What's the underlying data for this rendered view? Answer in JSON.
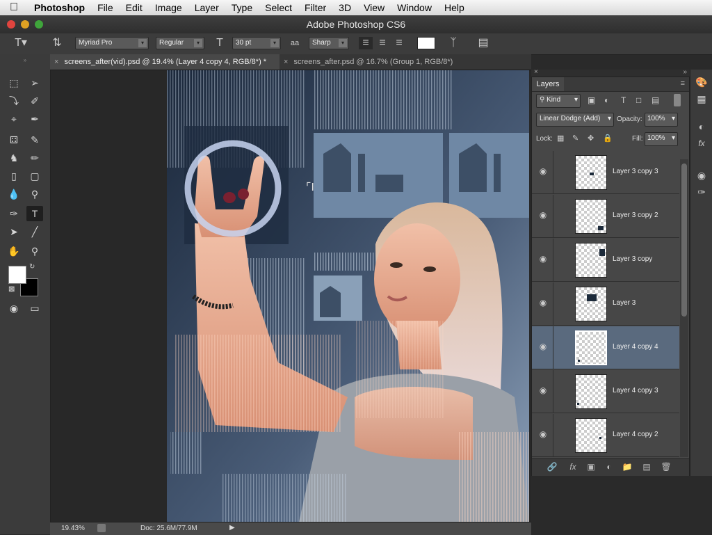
{
  "menubar": {
    "app_name": "Photoshop",
    "items": [
      "File",
      "Edit",
      "Image",
      "Layer",
      "Type",
      "Select",
      "Filter",
      "3D",
      "View",
      "Window",
      "Help"
    ]
  },
  "window": {
    "title": "Adobe Photoshop CS6"
  },
  "options_bar": {
    "font_family": "Myriad Pro",
    "font_style": "Regular",
    "font_size": "30 pt",
    "antialias": "Sharp",
    "text_color": "#ffffff"
  },
  "doc_tabs": [
    {
      "label": "screens_after(vid).psd @ 19.4% (Layer 4 copy 4, RGB/8*) *",
      "active": true
    },
    {
      "label": "screens_after.psd @ 16.7% (Group 1, RGB/8*)",
      "active": false
    }
  ],
  "status": {
    "zoom": "19.43%",
    "doc": "Doc: 25.6M/77.9M"
  },
  "layers_panel": {
    "tab": "Layers",
    "filter": "Kind",
    "blend_mode": "Linear Dodge (Add)",
    "opacity_label": "Opacity:",
    "opacity": "100%",
    "lock_label": "Lock:",
    "fill_label": "Fill:",
    "fill": "100%",
    "layers": [
      {
        "name": "Layer 3 copy 3",
        "selected": false
      },
      {
        "name": "Layer 3 copy 2",
        "selected": false
      },
      {
        "name": "Layer 3 copy",
        "selected": false
      },
      {
        "name": "Layer 3",
        "selected": false
      },
      {
        "name": "Layer 4 copy 4",
        "selected": true
      },
      {
        "name": "Layer 4 copy 3",
        "selected": false
      },
      {
        "name": "Layer 4 copy 2",
        "selected": false
      }
    ]
  },
  "colors": {
    "foreground": "#ffffff",
    "background": "#000000",
    "selected_layer": "#5a6a7e"
  },
  "icons": {
    "tools": [
      "marquee-tool-icon",
      "move-tool-icon",
      "lasso-tool-icon",
      "quick-select-tool-icon",
      "crop-tool-icon",
      "eyedropper-tool-icon",
      "spot-heal-tool-icon",
      "brush-tool-icon",
      "clone-stamp-tool-icon",
      "history-brush-tool-icon",
      "eraser-tool-icon",
      "gradient-tool-icon",
      "blur-tool-icon",
      "dodge-tool-icon",
      "pen-tool-icon",
      "type-tool-icon",
      "path-select-tool-icon",
      "line-tool-icon",
      "hand-tool-icon",
      "zoom-tool-icon"
    ]
  }
}
